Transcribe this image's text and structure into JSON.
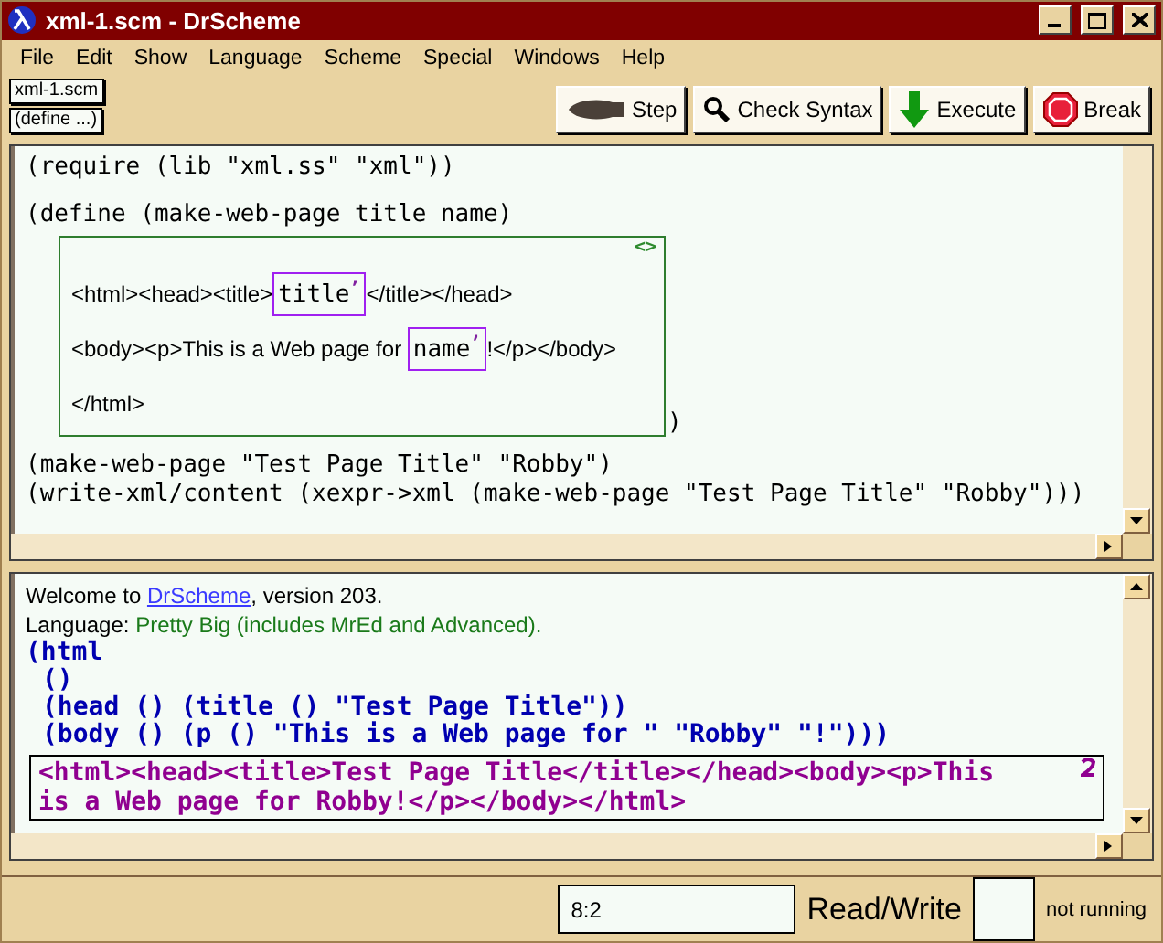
{
  "window": {
    "title": "xml-1.scm - DrScheme"
  },
  "menu": [
    "File",
    "Edit",
    "Show",
    "Language",
    "Scheme",
    "Special",
    "Windows",
    "Help"
  ],
  "file_buttons": [
    "xml-1.scm",
    "(define ...)"
  ],
  "toolbar": [
    {
      "kind": "step",
      "label": "Step"
    },
    {
      "kind": "check",
      "label": "Check Syntax"
    },
    {
      "kind": "execute",
      "label": "Execute"
    },
    {
      "kind": "break",
      "label": "Break"
    }
  ],
  "definitions": {
    "before": [
      "(require (lib \"xml.ss\" \"xml\"))",
      "(define (make-web-page title name)"
    ],
    "xml_box": {
      "label": "<>",
      "closing": ")",
      "lines": [
        [
          {
            "kind": "text",
            "text": "<html><head><title>"
          },
          {
            "kind": "scheme",
            "text": "title",
            "mark": ","
          },
          {
            "kind": "text",
            "text": "</title></head>"
          }
        ],
        [
          {
            "kind": "text",
            "text": "<body><p>This is a Web page for "
          },
          {
            "kind": "scheme",
            "text": "name",
            "mark": ","
          },
          {
            "kind": "text",
            "text": "!</p></body>"
          }
        ],
        [
          {
            "kind": "text",
            "text": "</html>"
          }
        ]
      ]
    },
    "after": [
      "(make-web-page \"Test Page Title\" \"Robby\")",
      "(write-xml/content (xexpr->xml (make-web-page \"Test Page Title\" \"Robby\")))"
    ]
  },
  "interactions": {
    "welcome": {
      "before": "Welcome to ",
      "link": "DrScheme",
      "after": ", version 203."
    },
    "language": {
      "label": "Language:",
      "value": "Pretty Big (includes MrEd and Advanced)."
    },
    "output": [
      "(html",
      "()",
      "(head () (title () \"Test Page Title\"))",
      "(body () (p () \"This is a Web page for \" \"Robby\" \"!\")))"
    ],
    "result": "<html><head><title>Test Page Title</title></head><body><p>This is a Web page for Robby!</p></body></html>"
  },
  "status_bar": {
    "position": "8:2",
    "mode": "Read/Write",
    "state": "not running"
  }
}
